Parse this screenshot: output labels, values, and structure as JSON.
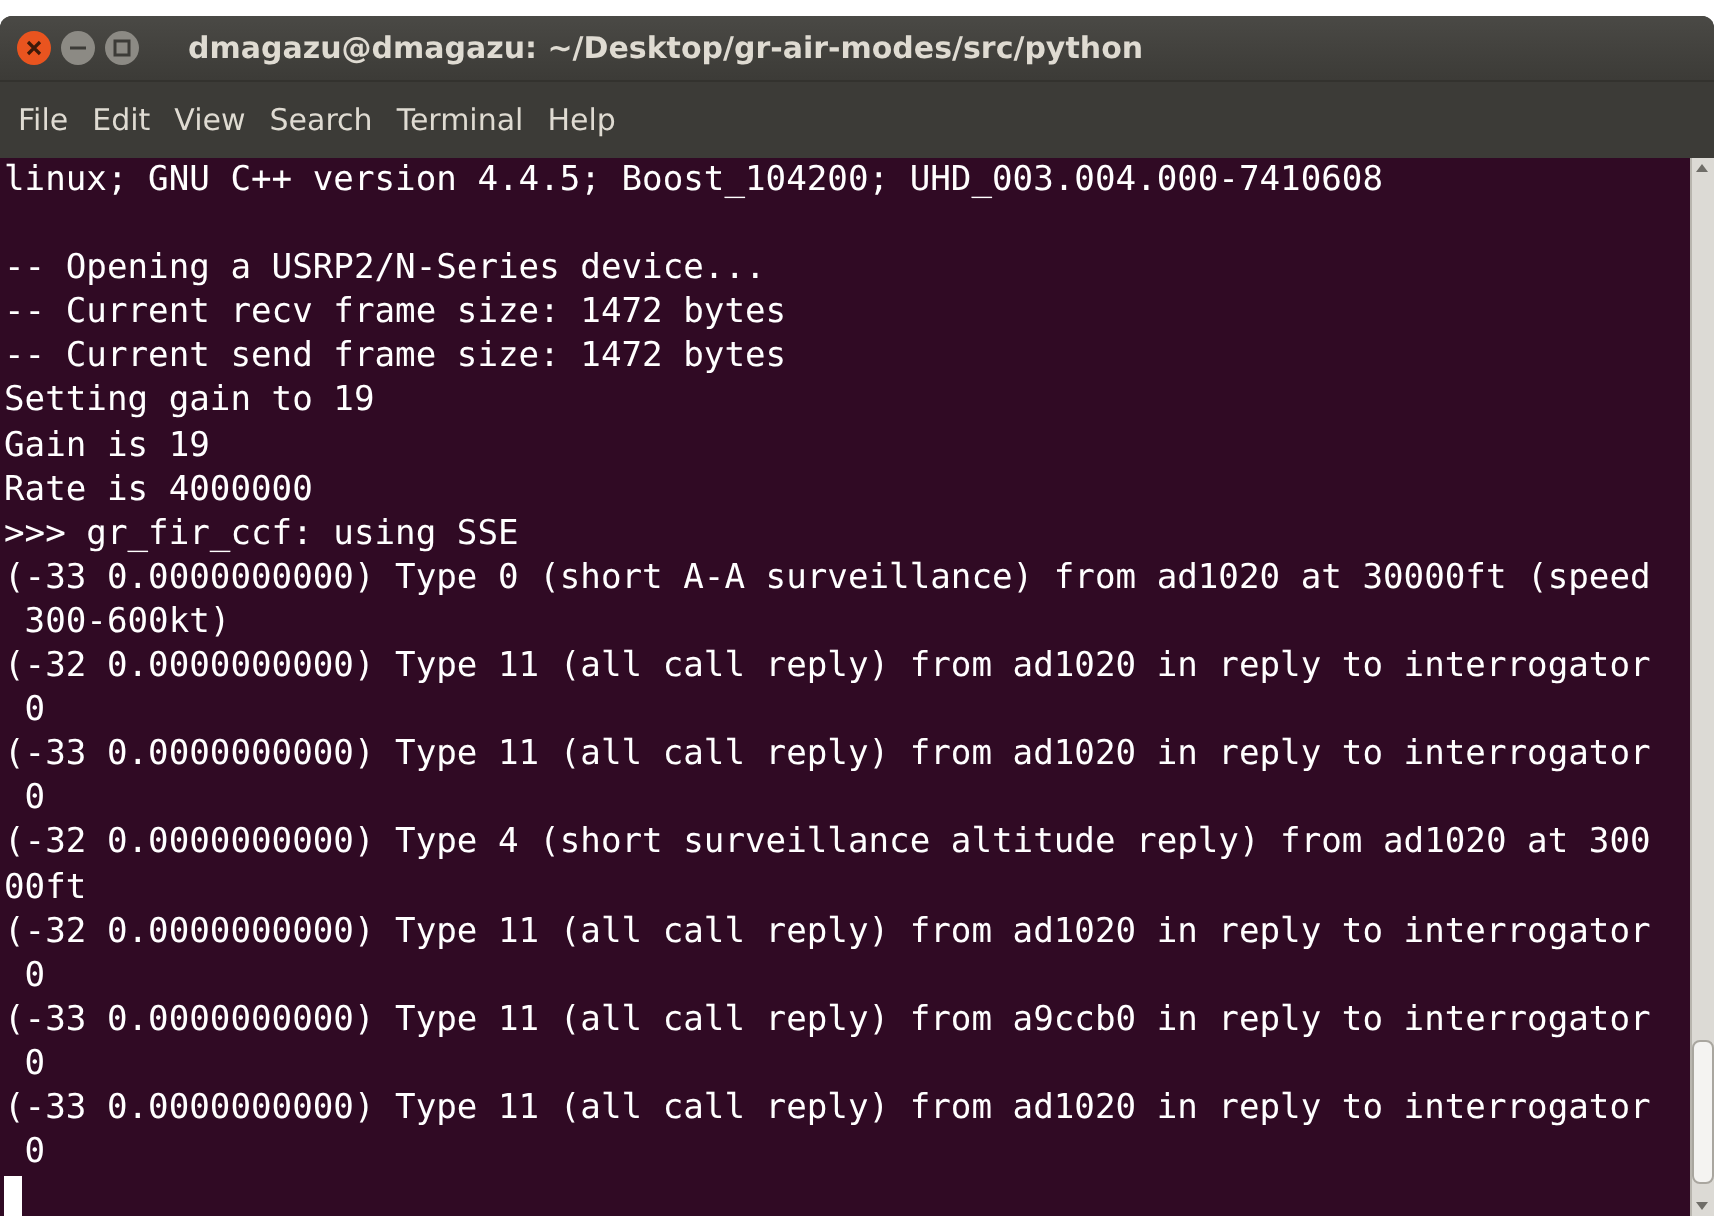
{
  "window": {
    "title": "dmagazu@dmagazu: ~/Desktop/gr-air-modes/src/python"
  },
  "menu": [
    "File",
    "Edit",
    "View",
    "Search",
    "Terminal",
    "Help"
  ],
  "terminal": {
    "lines": [
      {
        "kind": "text",
        "text": "linux; GNU C++ version 4.4.5; Boost_104200; UHD_003.004.000-7410608"
      },
      {
        "kind": "blank"
      },
      {
        "kind": "text",
        "text": "-- Opening a USRP2/N-Series device..."
      },
      {
        "kind": "text",
        "text": "-- Current recv frame size: 1472 bytes"
      },
      {
        "kind": "text",
        "text": "-- Current send frame size: 1472 bytes"
      },
      {
        "kind": "text",
        "text": "Setting gain to 19"
      },
      {
        "kind": "text",
        "text": "Gain is 19"
      },
      {
        "kind": "text",
        "text": "Rate is 4000000"
      },
      {
        "kind": "text",
        "text": ">>> gr_fir_ccf: using SSE"
      },
      {
        "kind": "text",
        "text": "(-33 0.0000000000) Type 0 (short A-A surveillance) from ad1020 at 30000ft (speed"
      },
      {
        "kind": "text",
        "text": " 300-600kt)"
      },
      {
        "kind": "text",
        "text": "(-32 0.0000000000) Type 11 (all call reply) from ad1020 in reply to interrogator"
      },
      {
        "kind": "text",
        "text": " 0"
      },
      {
        "kind": "text",
        "text": "(-33 0.0000000000) Type 11 (all call reply) from ad1020 in reply to interrogator"
      },
      {
        "kind": "text",
        "text": " 0"
      },
      {
        "kind": "text",
        "text": "(-32 0.0000000000) Type 4 (short surveillance altitude reply) from ad1020 at 300"
      },
      {
        "kind": "text",
        "text": "00ft"
      },
      {
        "kind": "text",
        "text": "(-32 0.0000000000) Type 11 (all call reply) from ad1020 in reply to interrogator"
      },
      {
        "kind": "text",
        "text": " 0"
      },
      {
        "kind": "text",
        "text": "(-33 0.0000000000) Type 11 (all call reply) from a9ccb0 in reply to interrogator"
      },
      {
        "kind": "text",
        "text": " 0"
      },
      {
        "kind": "text",
        "text": "(-33 0.0000000000) Type 11 (all call reply) from ad1020 in reply to interrogator"
      },
      {
        "kind": "text",
        "text": " 0"
      },
      {
        "kind": "cursor"
      }
    ]
  }
}
